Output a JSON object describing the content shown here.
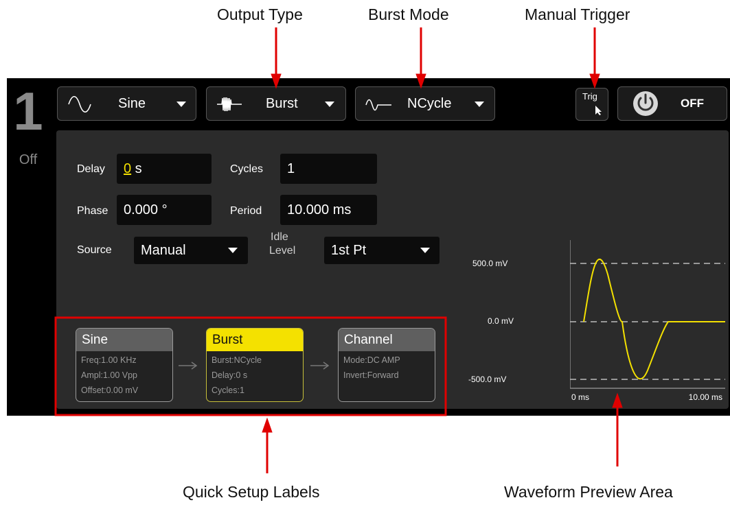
{
  "callouts": {
    "output_type": "Output Type",
    "burst_mode": "Burst Mode",
    "manual_trigger": "Manual Trigger",
    "quick_setup": "Quick Setup Labels",
    "waveform_preview": "Waveform Preview Area"
  },
  "channel": {
    "number": "1",
    "state": "Off"
  },
  "toolbar": {
    "waveform_label": "Sine",
    "output_type_label": "Burst",
    "burst_mode_label": "NCycle",
    "trigger_label": "Trig",
    "power_label": "OFF",
    "icons": [
      "sine-wave-icon",
      "burst-wave-icon",
      "ncycle-wave-icon",
      "cursor-icon",
      "power-icon"
    ]
  },
  "settings": {
    "delay": {
      "label": "Delay",
      "value_digit": "0",
      "value_unit": " s"
    },
    "cycles": {
      "label": "Cycles",
      "value": "1"
    },
    "phase": {
      "label": "Phase",
      "value": "0.000 °"
    },
    "period": {
      "label": "Period",
      "value": "10.000 ms"
    },
    "source": {
      "label": "Source",
      "value": "Manual"
    },
    "idle_level": {
      "label_line1": "Idle",
      "label_line2": "Level",
      "value": "1st Pt"
    }
  },
  "quick_setup": [
    {
      "title": "Sine",
      "lines": [
        "Freq:1.00 KHz",
        "Ampl:1.00 Vpp",
        "Offset:0.00 mV"
      ]
    },
    {
      "title": "Burst",
      "lines": [
        "Burst:NCycle",
        "Delay:0 s",
        "Cycles:1"
      ]
    },
    {
      "title": "Channel",
      "lines": [
        "Mode:DC AMP",
        "Invert:Forward"
      ]
    }
  ],
  "preview": {
    "y_labels": [
      "500.0 mV",
      "0.0 mV",
      "-500.0 mV"
    ],
    "x_labels": [
      "0 ms",
      "10.00 ms"
    ]
  },
  "colors": {
    "accent": "#f4e100",
    "callout_arrow": "#e00000",
    "panel": "#2b2b2b",
    "screen": "#000000",
    "highlight_box": "#e00000"
  }
}
